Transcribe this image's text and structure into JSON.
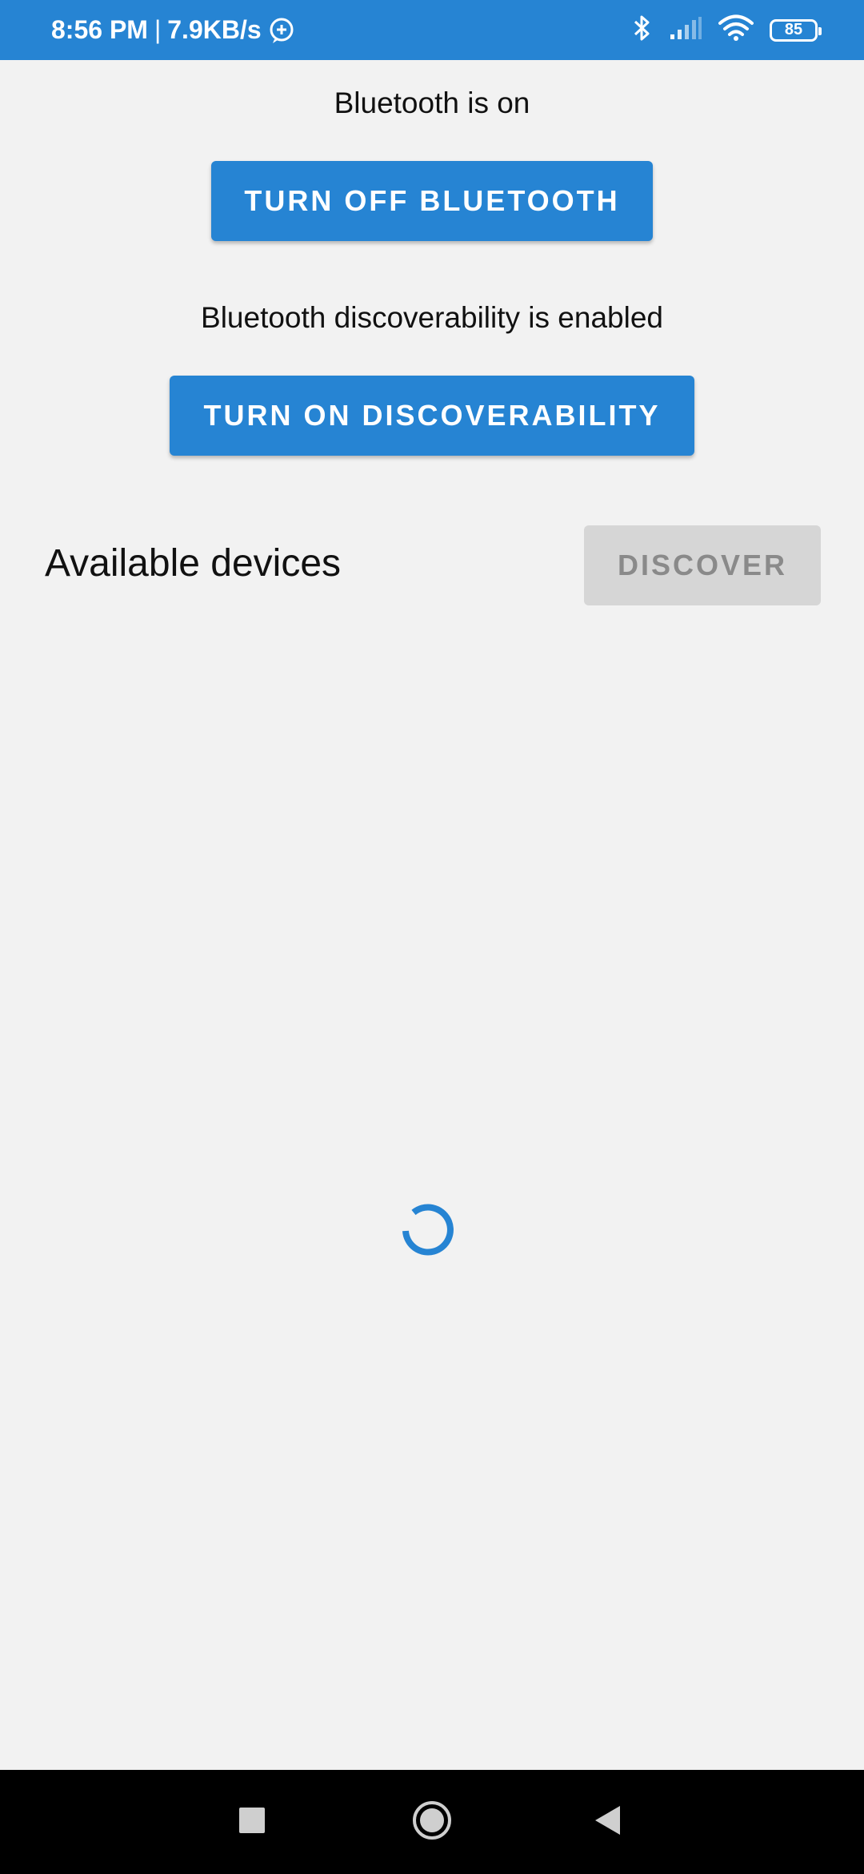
{
  "status_bar": {
    "time": "8:56 PM",
    "separator": "|",
    "network_speed": "7.9KB/s",
    "battery_level": "85",
    "icons": [
      "notification-icon",
      "bluetooth-icon",
      "signal-icon",
      "wifi-icon",
      "battery-icon"
    ]
  },
  "bluetooth": {
    "status_text": "Bluetooth is on",
    "toggle_label": "TURN OFF BLUETOOTH"
  },
  "discoverability": {
    "status_text": "Bluetooth discoverability is enabled",
    "toggle_label": "TURN ON DISCOVERABILITY"
  },
  "devices": {
    "title": "Available devices",
    "discover_label": "DISCOVER"
  },
  "navigation": {
    "icons": [
      "recents-icon",
      "home-icon",
      "back-icon"
    ]
  },
  "colors": {
    "accent": "#2684d3",
    "background": "#f2f2f2",
    "disabled_bg": "#d6d6d6",
    "disabled_text": "#8a8a8a"
  }
}
